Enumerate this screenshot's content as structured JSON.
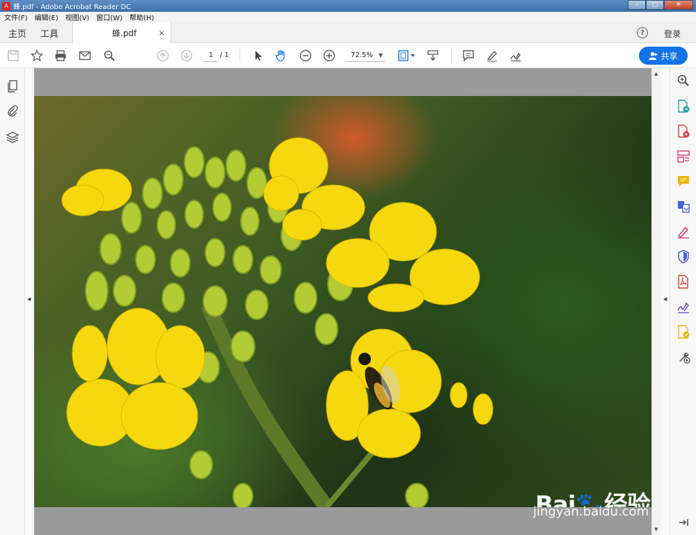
{
  "window": {
    "title": "蜂.pdf - Adobe Acrobat Reader DC"
  },
  "menu": [
    "文件(F)",
    "编辑(E)",
    "视图(V)",
    "窗口(W)",
    "帮助(H)"
  ],
  "nav": {
    "home": "主页",
    "tools": "工具"
  },
  "tab": {
    "label": "蜂.pdf",
    "close": "×"
  },
  "account": {
    "help": "?",
    "login": "登录"
  },
  "toolbar": {
    "page_current": "1",
    "page_total": "/ 1",
    "zoom": "72.5%",
    "share_label": "共享"
  },
  "watermark": {
    "brand": "Bai",
    "brand2": "经验",
    "url": "jingyan.baidu.com"
  },
  "colors": {
    "accent": "#1473e6",
    "flower": "#f6d80f"
  },
  "icons": {
    "left_panel": [
      "pages-icon",
      "attachment-icon",
      "layers-icon"
    ],
    "right_panel": [
      "zoom-in-icon",
      "export-pdf-icon",
      "create-pdf-icon",
      "edit-pdf-icon",
      "comment-icon",
      "combine-files-icon",
      "fill-sign-icon",
      "protect-icon",
      "pdf-icon",
      "sign-icon",
      "send-for-review-icon",
      "more-tools-icon",
      "collapse-panel-icon"
    ]
  }
}
